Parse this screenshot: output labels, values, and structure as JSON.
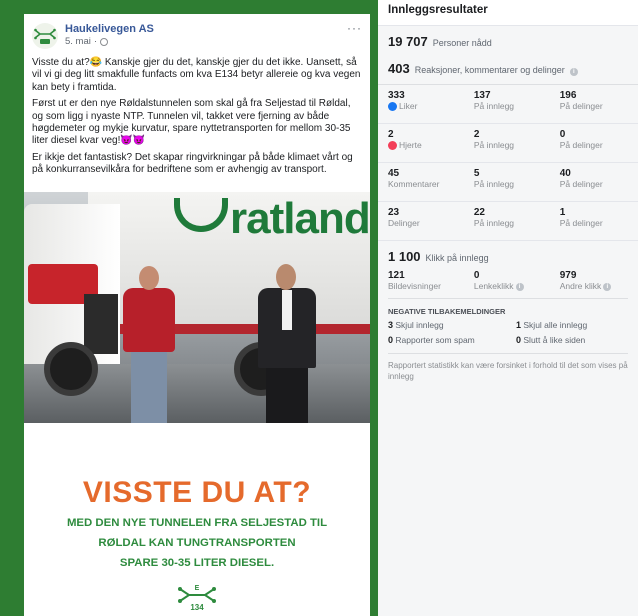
{
  "post": {
    "page_name": "Haukelivegen AS",
    "date": "5. mai",
    "more_label": "···",
    "paragraphs": [
      "Visste du at?😂 Kanskje gjer du det, kanskje gjer du det ikke. Uansett, så vil vi gi deg litt smakfulle funfacts om kva E134 betyr allereie og kva vegen kan bety i framtida.",
      "Først ut er den nye Røldalstunnelen som skal gå fra Seljestad til Røldal, og som ligg i nyaste NTP. Tunnelen vil, takket vere fjerning av både høgdemeter og mykje kurvatur, spare nyttetransporten for mellom 30-35 liter diesel kvar veg!😈😈",
      "Er ikkje det fantastisk? Det skapar ringvirkningar på både klimaet vårt og på konkurransevilkåra for bedriftene som er avhengig av transport."
    ],
    "image": {
      "truck_brand": "ratland",
      "headline": "VISSTE DU AT?",
      "subline": [
        "MED DEN NYE TUNNELEN FRA SELJESTAD TIL",
        "RØLDAL KAN TUNGTRANSPORTEN",
        "SPARE 30-35 LITER DIESEL."
      ],
      "logo_letter": "E",
      "logo_number": "134"
    }
  },
  "insights": {
    "title": "Innleggsresultater",
    "reach": {
      "value": "19 707",
      "label": "Personer nådd"
    },
    "engagement": {
      "value": "403",
      "label": "Reaksjoner, kommentarer og delinger"
    },
    "rows": [
      [
        {
          "value": "333",
          "label": "Liker",
          "icon": "like-icon"
        },
        {
          "value": "137",
          "label": "På innlegg"
        },
        {
          "value": "196",
          "label": "På delinger"
        }
      ],
      [
        {
          "value": "2",
          "label": "Hjerte",
          "icon": "heart-icon"
        },
        {
          "value": "2",
          "label": "På innlegg"
        },
        {
          "value": "0",
          "label": "På delinger"
        }
      ],
      [
        {
          "value": "45",
          "label": "Kommentarer"
        },
        {
          "value": "5",
          "label": "På innlegg"
        },
        {
          "value": "40",
          "label": "På delinger"
        }
      ],
      [
        {
          "value": "23",
          "label": "Delinger"
        },
        {
          "value": "22",
          "label": "På innlegg"
        },
        {
          "value": "1",
          "label": "På delinger"
        }
      ]
    ],
    "clicks": {
      "value": "1 100",
      "label": "Klikk på innlegg"
    },
    "click_breakdown": [
      {
        "value": "121",
        "label": "Bildevisninger"
      },
      {
        "value": "0",
        "label": "Lenkeklikk"
      },
      {
        "value": "979",
        "label": "Andre klikk"
      }
    ],
    "negative": {
      "title": "NEGATIVE TILBAKEMELDINGER",
      "items": [
        {
          "value": "3",
          "label": "Skjul innlegg"
        },
        {
          "value": "1",
          "label": "Skjul alle innlegg"
        },
        {
          "value": "0",
          "label": "Rapporter som spam"
        },
        {
          "value": "0",
          "label": "Slutt å like siden"
        }
      ]
    },
    "footnote": "Rapportert statistikk kan være forsinket i forhold til det som vises på innlegg",
    "colors": {
      "like": "#1877f2",
      "heart": "#f33e58",
      "brand_green": "#1f7a3a",
      "headline_orange": "#e56a2c"
    }
  }
}
